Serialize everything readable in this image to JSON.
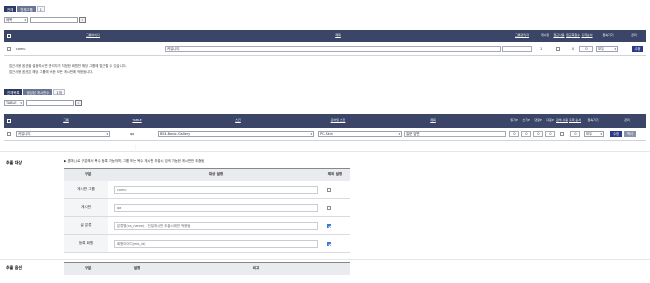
{
  "top": {
    "tabs": [
      "전체",
      "전체그룹",
      "1"
    ],
    "select_value": "제목",
    "search_icon": "search-icon"
  },
  "group_table": {
    "headers": [
      "그룹아이디",
      "제목",
      "그룹관리자",
      "게시판",
      "접근사용",
      "접근회원수",
      "출력순서",
      "접속기기",
      "관리"
    ],
    "row": {
      "id": "comu",
      "subject": "커뮤니티",
      "admin": "",
      "boards": "1",
      "use_access": false,
      "access_count": "0",
      "order": "0",
      "device": "모두",
      "action": "수정"
    },
    "notes": [
      "접근사용 옵션을 설정하시면 관리자가 지정한 회원만 해당 그룹에 접근할 수 있습니다.",
      "접근사용 옵션은 해당 그룹에 속한 모든 게시판에 적용됩니다."
    ]
  },
  "board": {
    "tabs": [
      "전체목록",
      "생성된 게시판수",
      "1개"
    ],
    "select_value": "TABLE",
    "headers": [
      "그룹",
      "TABLE",
      "스킨",
      "모바일 스킨",
      "제목",
      "읽기P",
      "쓰기P",
      "댓글P",
      "다운P",
      "검색 사용",
      "출력 순서",
      "접속기기",
      "관리"
    ],
    "row": {
      "group": "커뮤니티",
      "table": "qa",
      "skin": "BS4-Basic-Gallery",
      "mobile_skin": "PC-Skin",
      "subject": "질문 답변",
      "read_point": "0",
      "write_point": "0",
      "comment_point": "0",
      "download_point": "0",
      "search": false,
      "order": "0",
      "device": "모두",
      "edit": "수정",
      "copy": "복사"
    }
  },
  "extract_target": {
    "title": "추출 대상",
    "description": "▶ 콤마(,)로 구분해서 복수 등록 가능하며, 그룹 또는 복수 게시판 추출시 검색 가능한 게시판만 추출됨",
    "headers": [
      "구분",
      "대상 설정",
      "제외 설정"
    ],
    "rows": [
      {
        "label": "게시판 그룹",
        "value": "comu",
        "excluded": false
      },
      {
        "label": "게시판",
        "value": "qa",
        "excluded": false
      },
      {
        "label": "글 분류",
        "value": "분류명(ca_name) - 단일게시판 추출시에만 적용됨",
        "excluded": true
      },
      {
        "label": "등록 회원",
        "value": "회원아이디(mb_id)",
        "excluded": true
      }
    ]
  },
  "extract_options": {
    "title": "추출 옵션",
    "headers": [
      "구분",
      "설정",
      "비고"
    ]
  }
}
